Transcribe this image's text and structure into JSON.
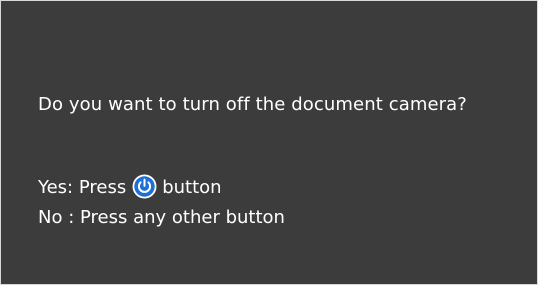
{
  "dialog": {
    "question": "Do you want to turn off the document camera?",
    "yes": {
      "prefix": "Yes: Press",
      "suffix": "button",
      "icon": "power-icon",
      "icon_color": "#1e6fd6"
    },
    "no": {
      "text": "No : Press any other button"
    }
  },
  "colors": {
    "background": "#3c3c3c",
    "text": "#ffffff",
    "border": "#d8d8d8"
  }
}
